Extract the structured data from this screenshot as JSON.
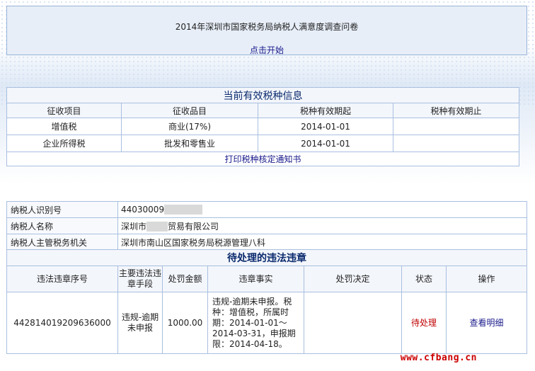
{
  "survey": {
    "title": "2014年深圳市国家税务局纳税人满意度调查问卷",
    "start_link": "点击开始"
  },
  "tax_info": {
    "title": "当前有效税种信息",
    "columns": [
      "征收项目",
      "征收品目",
      "税种有效期起",
      "税种有效期止"
    ],
    "rows": [
      {
        "item": "增值税",
        "category": "商业(17%)",
        "start": "2014-01-01",
        "end": ""
      },
      {
        "item": "企业所得税",
        "category": "批发和零售业",
        "start": "2014-01-01",
        "end": ""
      }
    ],
    "print_link": "打印税种核定通知书"
  },
  "taxpayer": {
    "id_label": "纳税人识别号",
    "id_value": "44030009",
    "name_label": "纳税人名称",
    "name_prefix": "深圳市",
    "name_suffix": "贸易有限公司",
    "authority_label": "纳税人主管税务机关",
    "authority_value": "深圳市南山区国家税务局税源管理八科"
  },
  "violations": {
    "title": "待处理的违法违章",
    "columns": [
      "违法违章序号",
      "主要违法违章手段",
      "处罚金额",
      "违章事实",
      "处罚决定",
      "状态",
      "操作"
    ],
    "rows": [
      {
        "serial": "442814019209636000",
        "means": "违规-逾期未申报",
        "penalty": "1000.00",
        "facts": "违规-逾期未申报。税种：增值税，所属时期：2014-01-01～2014-03-31，申报期限：2014-04-18。",
        "decision": "",
        "status": "待处理",
        "action": "查看明细"
      }
    ]
  },
  "watermark": "www.cfbang.cn"
}
